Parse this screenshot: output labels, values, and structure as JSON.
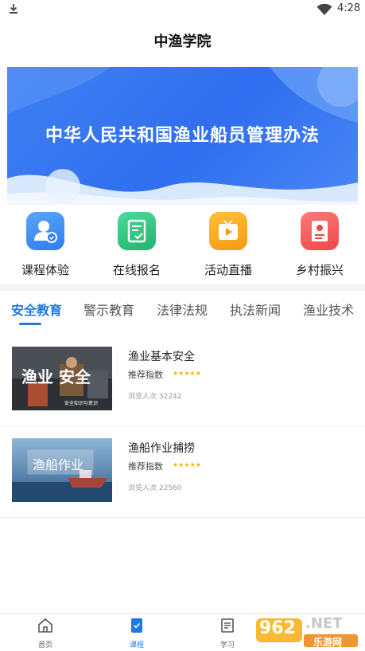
{
  "status_bar": {
    "time": "4:28"
  },
  "header": {
    "title": "中渔学院"
  },
  "banner": {
    "text": "中华人民共和国渔业船员管理办法"
  },
  "quick_menu": [
    {
      "label": "课程体验",
      "icon": "user-badge-icon",
      "color": "#3c8df5"
    },
    {
      "label": "在线报名",
      "icon": "form-check-icon",
      "color": "#2ec27e"
    },
    {
      "label": "活动直播",
      "icon": "tv-play-icon",
      "color": "#f7a21a"
    },
    {
      "label": "乡村振兴",
      "icon": "book-badge-icon",
      "color": "#f25a5a"
    }
  ],
  "tabs": [
    {
      "label": "安全教育",
      "active": true
    },
    {
      "label": "警示教育"
    },
    {
      "label": "法律法规"
    },
    {
      "label": "执法新闻"
    },
    {
      "label": "渔业技术"
    }
  ],
  "courses": [
    {
      "title": "渔业基本安全",
      "rating_label": "推荐指数",
      "stars": "★★★★★",
      "rating": 5,
      "views": "浏览人次 32242",
      "thumb_text": "渔业 安全",
      "thumb_caption": "安全知识与意识"
    },
    {
      "title": "渔船作业捕捞",
      "rating_label": "推荐指数",
      "stars": "★★★★★",
      "rating": 5,
      "views": "浏览人次 22560",
      "thumb_text": "渔船作业"
    }
  ],
  "bottom_nav": [
    {
      "label": "首页",
      "icon": "home-icon"
    },
    {
      "label": "课程",
      "icon": "course-icon",
      "active": true
    },
    {
      "label": "学习",
      "icon": "study-icon"
    }
  ],
  "watermark": {
    "text_main": "962",
    "text_suffix": ".NET",
    "text_sub": "乐游网"
  },
  "colors": {
    "accent": "#1f7ae0",
    "banner": "#2f6ff0",
    "star": "#f2b400"
  }
}
